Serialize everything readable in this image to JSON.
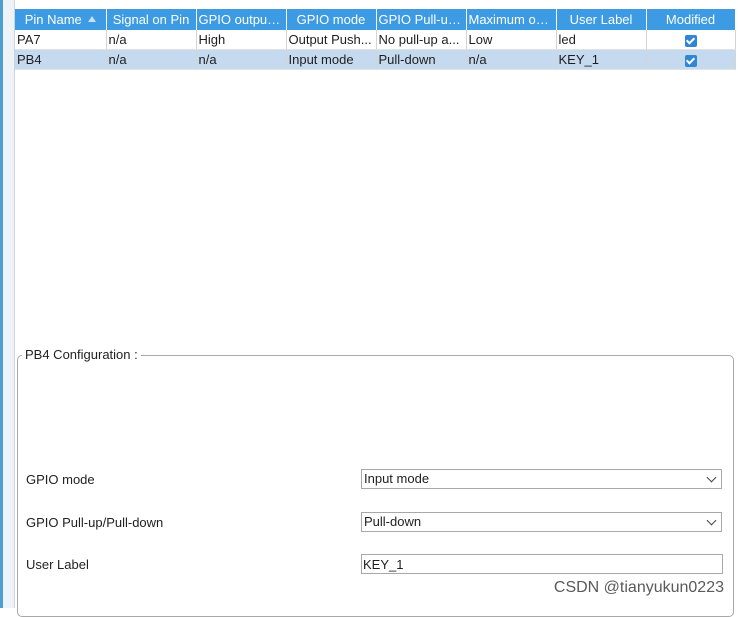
{
  "table": {
    "columns": [
      "Pin Name",
      "Signal on Pin",
      "GPIO output ...",
      "GPIO mode",
      "GPIO Pull-up...",
      "Maximum ou...",
      "User Label",
      "Modified"
    ],
    "rows": [
      {
        "pin": "PA7",
        "signal": "n/a",
        "output": "High",
        "mode": "Output Push...",
        "pull": "No pull-up a...",
        "speed": "Low",
        "label": "led",
        "modified": true
      },
      {
        "pin": "PB4",
        "signal": "n/a",
        "output": "n/a",
        "mode": "Input mode",
        "pull": "Pull-down",
        "speed": "n/a",
        "label": "KEY_1",
        "modified": true
      }
    ]
  },
  "config": {
    "title": "PB4 Configuration :",
    "fields": {
      "gpio_mode_label": "GPIO mode",
      "gpio_mode_value": "Input mode",
      "pull_label": "GPIO Pull-up/Pull-down",
      "pull_value": "Pull-down",
      "user_label_label": "User Label",
      "user_label_value": "KEY_1"
    }
  },
  "watermark": "CSDN @tianyukun0223",
  "colors": {
    "header": "#3c9be3",
    "selected_row": "#c5d9ef"
  },
  "icons": {
    "sort": "sort-up-icon",
    "modified": "checkbox-checked-icon",
    "dropdown": "chevron-down-icon"
  }
}
